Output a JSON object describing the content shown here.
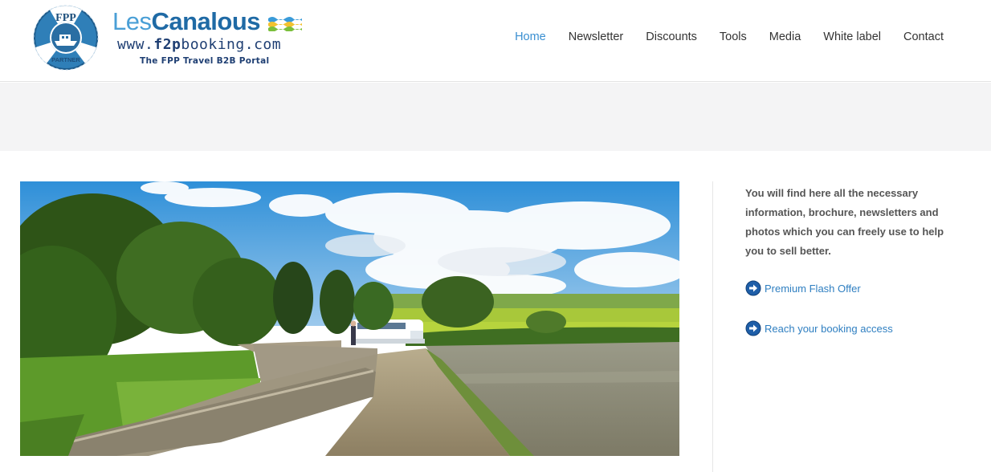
{
  "header": {
    "badge": {
      "top_text": "FPP",
      "bottom_text": "PARTNER"
    },
    "brand": {
      "name_prefix": "Les",
      "name_main": "Canalous",
      "url_prefix": "www.",
      "url_bold": "f2p",
      "url_suffix": "booking.com",
      "tagline": "The FPP Travel B2B Portal"
    },
    "nav": [
      {
        "label": "Home",
        "active": true
      },
      {
        "label": "Newsletter",
        "active": false
      },
      {
        "label": "Discounts",
        "active": false
      },
      {
        "label": "Tools",
        "active": false
      },
      {
        "label": "Media",
        "active": false
      },
      {
        "label": "White label",
        "active": false
      },
      {
        "label": "Contact",
        "active": false
      }
    ]
  },
  "sidebar": {
    "intro": "You will find here all the necessary information, brochure, newsletters and photos which you can freely use to help you to sell better.",
    "links": [
      {
        "label": "Premium Flash Offer",
        "icon": "arrow-circle-icon"
      },
      {
        "label": "Reach your booking access",
        "icon": "arrow-circle-icon"
      }
    ]
  },
  "colors": {
    "accent": "#3a8fd1",
    "brand_dark": "#1f3f73",
    "band": "#f4f4f5"
  }
}
